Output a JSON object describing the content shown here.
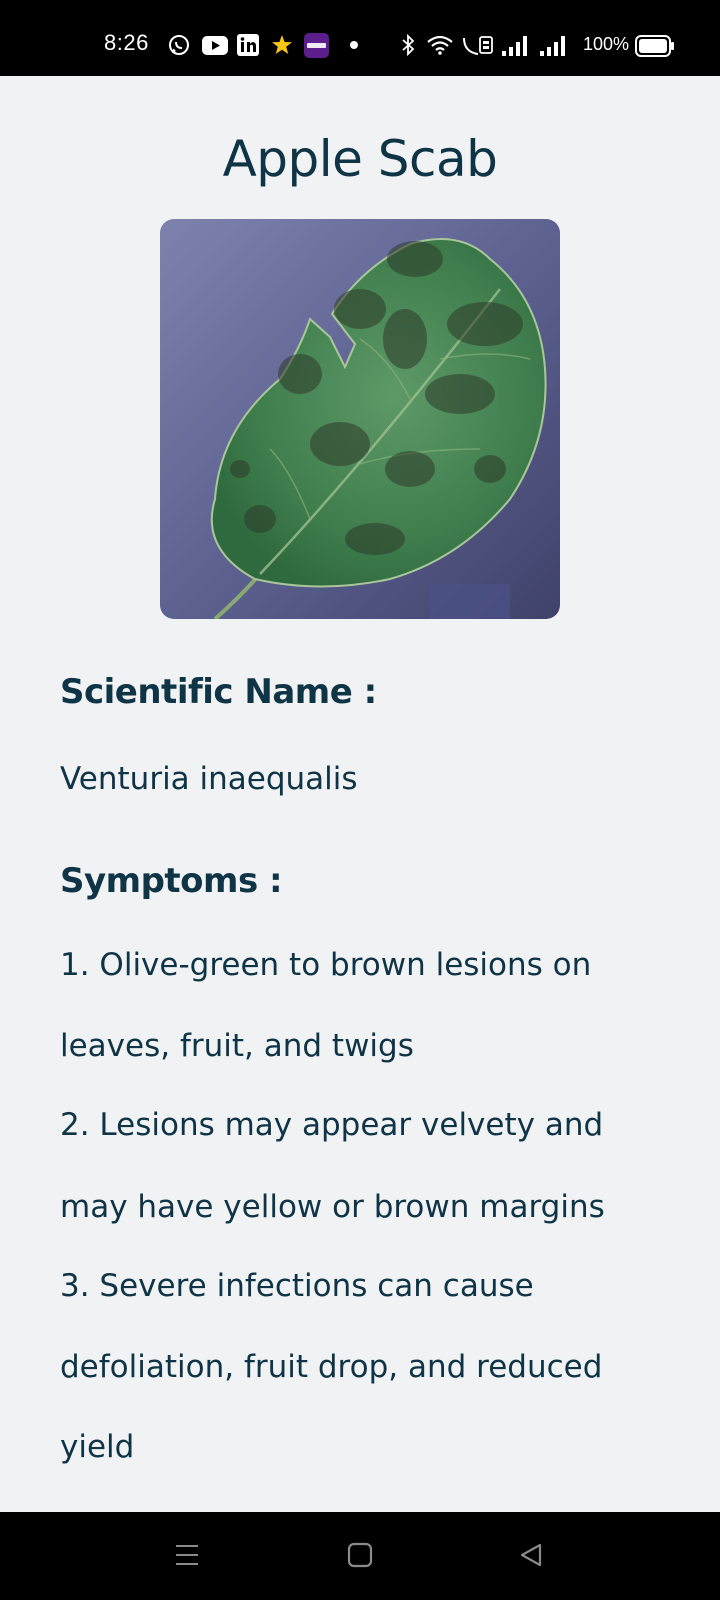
{
  "status_bar": {
    "time": "8:26",
    "notification_icons": [
      "whatsapp-icon",
      "youtube-icon",
      "linkedin-icon",
      "star-icon",
      "yono-sbi-icon",
      "dot-icon"
    ],
    "system_icons": [
      "bluetooth-icon",
      "wifi-icon",
      "volte-icon",
      "signal-icon",
      "signal-icon",
      "battery-icon"
    ],
    "battery": "100%"
  },
  "page": {
    "title": "Apple Scab",
    "image_subject": "apple-leaf-with-scab-lesions",
    "scientific_name_heading": "Scientific Name :",
    "scientific_name": "Venturia inaequalis",
    "symptoms_heading": "Symptoms :",
    "symptom_lines": [
      "1. Olive-green to brown lesions on",
      "leaves, fruit, and twigs",
      "2. Lesions may appear velvety and",
      "may have yellow or brown margins",
      "3. Severe infections can cause",
      "defoliation, fruit drop, and reduced",
      "yield"
    ]
  },
  "nav_bar": {
    "buttons": [
      "menu-icon",
      "home-icon",
      "back-icon"
    ]
  },
  "colors": {
    "text": "#0f3446",
    "background": "#f1f2f4",
    "system_bars": "#000000"
  }
}
